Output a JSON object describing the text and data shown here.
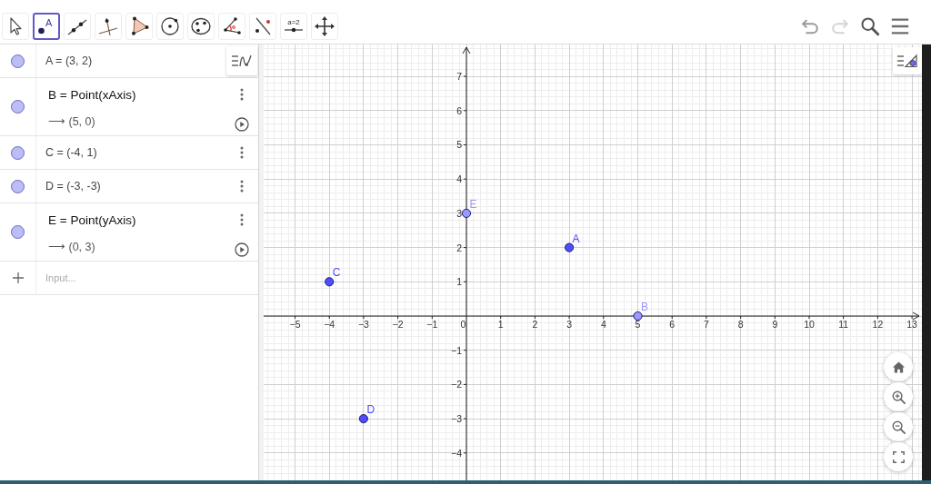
{
  "toolbar": {
    "tools": [
      {
        "kind": "move",
        "selected": false
      },
      {
        "kind": "point",
        "selected": true,
        "glyph": "A"
      },
      {
        "kind": "line",
        "selected": false
      },
      {
        "kind": "perpendicular",
        "selected": false
      },
      {
        "kind": "polygon",
        "selected": false
      },
      {
        "kind": "circle",
        "selected": false
      },
      {
        "kind": "conic",
        "selected": false
      },
      {
        "kind": "angle",
        "selected": false
      },
      {
        "kind": "reflect",
        "selected": false
      },
      {
        "kind": "slider",
        "selected": false,
        "glyph": "a=2"
      },
      {
        "kind": "pan",
        "selected": false
      }
    ],
    "actions": [
      {
        "kind": "undo",
        "disabled": false
      },
      {
        "kind": "redo",
        "disabled": true
      },
      {
        "kind": "search",
        "disabled": false
      },
      {
        "kind": "menu",
        "disabled": false
      }
    ]
  },
  "algebra": {
    "rows": [
      {
        "kind": "value",
        "visible": true,
        "text": "A = (3, 2)"
      },
      {
        "kind": "dependent",
        "visible": true,
        "definition": "B = Point(xAxis)",
        "value": "⟶ (5, 0)"
      },
      {
        "kind": "value",
        "visible": true,
        "text": "C = (-4, 1)"
      },
      {
        "kind": "value",
        "visible": true,
        "text": "D = (-3, -3)"
      },
      {
        "kind": "dependent",
        "visible": true,
        "definition": "E = Point(yAxis)",
        "value": "⟶ (0, 3)"
      }
    ],
    "input": {
      "placeholder": "Input..."
    }
  },
  "graphics": {
    "chart_data": {
      "type": "scatter",
      "x": [
        3,
        5,
        -4,
        -3,
        0
      ],
      "series": [
        {
          "name": "A",
          "color": "#4d4dff",
          "values": [
            2,
            null,
            null,
            null,
            null
          ]
        },
        {
          "name": "B",
          "color": "#9999ff",
          "values": [
            null,
            0,
            null,
            null,
            null
          ]
        },
        {
          "name": "C",
          "color": "#4d4dff",
          "values": [
            null,
            null,
            1,
            null,
            null
          ]
        },
        {
          "name": "D",
          "color": "#4d4dff",
          "values": [
            null,
            null,
            null,
            -3,
            null
          ]
        },
        {
          "name": "E",
          "color": "#9999ff",
          "values": [
            null,
            null,
            null,
            null,
            3
          ]
        }
      ],
      "xlim": [
        -5.915,
        13.289
      ],
      "ylim": [
        -4.801,
        7.931
      ],
      "xticks": [
        {
          "value": -5,
          "label": "−5"
        },
        {
          "value": -4,
          "label": "−4"
        },
        {
          "value": -3,
          "label": "−3"
        },
        {
          "value": -2,
          "label": "−2"
        },
        {
          "value": -1,
          "label": "−1"
        },
        0,
        1,
        2,
        3,
        4,
        5,
        6,
        7,
        8,
        9,
        10,
        11,
        12,
        13
      ],
      "yticks": [
        {
          "value": -4,
          "label": "−4"
        },
        {
          "value": -3,
          "label": "−3"
        },
        {
          "value": -2,
          "label": "−2"
        },
        {
          "value": -1,
          "label": "−1"
        },
        1,
        2,
        3,
        4,
        5,
        6,
        7
      ],
      "grid": true
    }
  }
}
